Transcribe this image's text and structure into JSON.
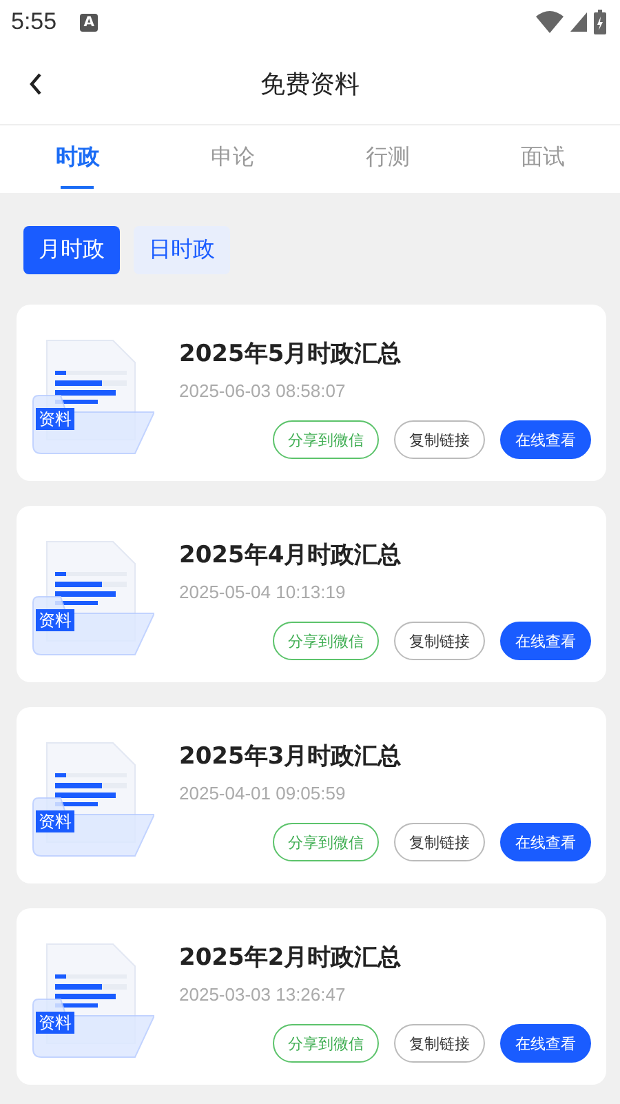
{
  "status_bar": {
    "time": "5:55",
    "notification": "A"
  },
  "header": {
    "title": "免费资料"
  },
  "tabs": [
    {
      "label": "时政",
      "selected": true
    },
    {
      "label": "申论",
      "selected": false
    },
    {
      "label": "行测",
      "selected": false
    },
    {
      "label": "面试",
      "selected": false
    }
  ],
  "segments": [
    {
      "label": "月时政",
      "selected": true
    },
    {
      "label": "日时政",
      "selected": false
    }
  ],
  "items": [
    {
      "badge": "资料",
      "title": "2025年5月时政汇总",
      "date": "2025-06-03 08:58:07",
      "actions": [
        "分享到微信",
        "复制链接",
        "在线查看"
      ]
    },
    {
      "badge": "资料",
      "title": "2025年4月时政汇总",
      "date": "2025-05-04 10:13:19",
      "actions": [
        "分享到微信",
        "复制链接",
        "在线查看"
      ]
    },
    {
      "badge": "资料",
      "title": "2025年3月时政汇总",
      "date": "2025-04-01 09:05:59",
      "actions": [
        "分享到微信",
        "复制链接",
        "在线查看"
      ]
    },
    {
      "badge": "资料",
      "title": "2025年2月时政汇总",
      "date": "2025-03-03 13:26:47",
      "actions": [
        "分享到微信",
        "复制链接",
        "在线查看"
      ]
    }
  ]
}
